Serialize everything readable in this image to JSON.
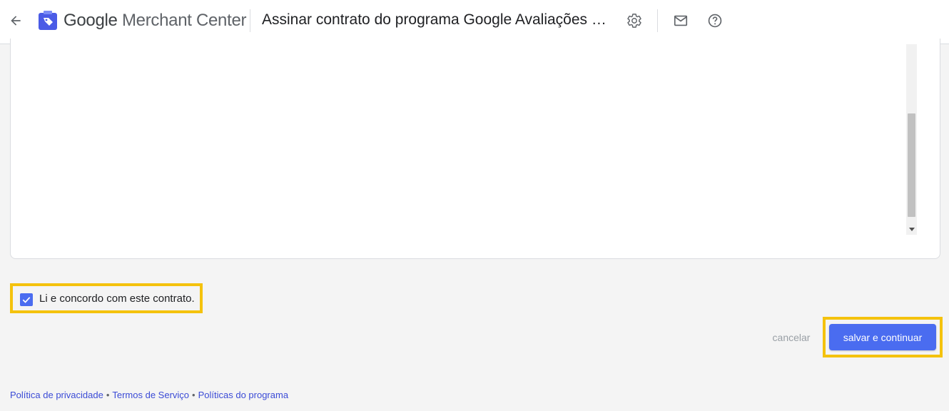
{
  "header": {
    "brand_google": "Google",
    "brand_product": "Merchant Center",
    "page_title": "Assinar contrato do programa Google Avaliações do Consumidor",
    "icons": {
      "back": "arrow-back-icon",
      "logo": "merchant-center-logo",
      "settings": "gear-icon",
      "mail": "mail-icon",
      "help": "help-icon"
    }
  },
  "agreement": {
    "checkbox_checked": true,
    "checkbox_label": "Li e concordo com este contrato."
  },
  "actions": {
    "cancel_label": "cancelar",
    "save_label": "salvar e continuar"
  },
  "footer": {
    "links": [
      "Política de privacidade",
      "Termos de Serviço",
      "Políticas do programa"
    ],
    "separator": "•"
  },
  "colors": {
    "accent": "#4a6cf0",
    "highlight": "#f4c20d",
    "background": "#f4f4f4"
  }
}
